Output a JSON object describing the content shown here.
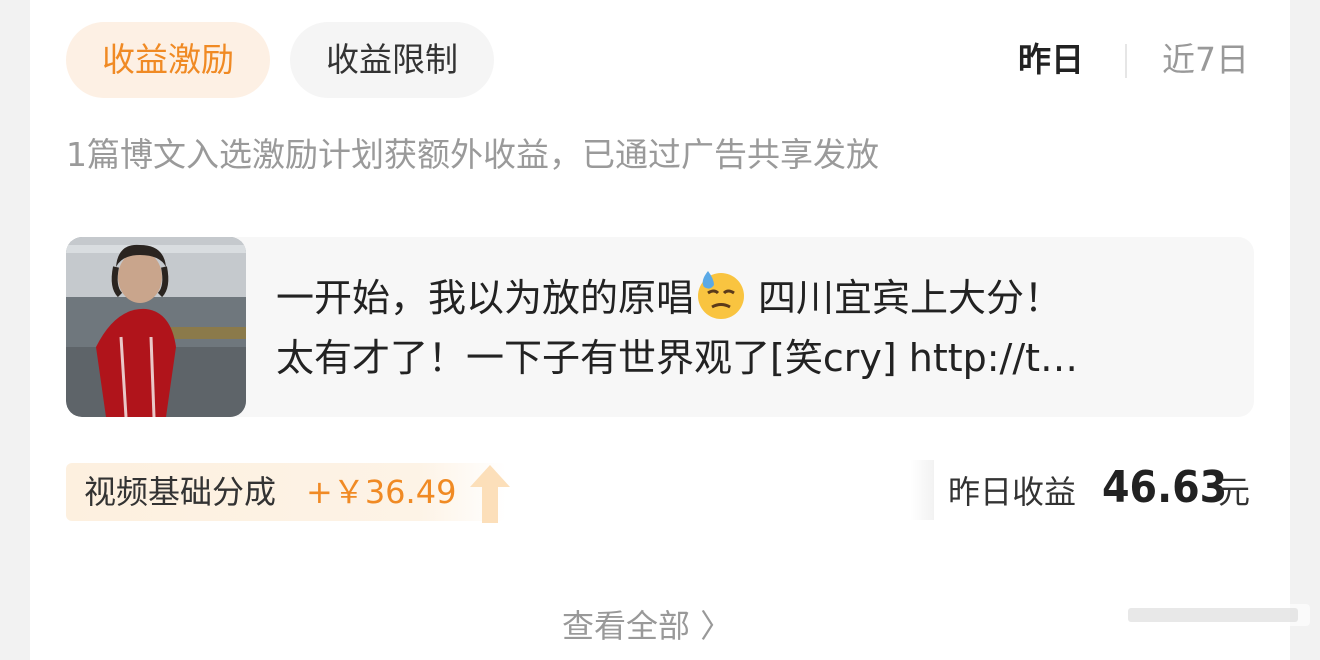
{
  "tabs": [
    {
      "label": "收益激励",
      "active": true
    },
    {
      "label": "收益限制",
      "active": false
    }
  ],
  "range": {
    "yesterday": "昨日",
    "last7days": "近7日"
  },
  "subtitle": "1篇博文入选激励计划获额外收益，已通过广告共享发放",
  "post": {
    "line1_a": "一开始，我以为放的原唱",
    "line1_emoji": "sweat-face-emoji",
    "line1_b": "四川宜宾上大分！",
    "line2": "太有才了！一下子有世界观了[笑cry] http://t…"
  },
  "revenue_share": {
    "label": "视频基础分成",
    "value": "+￥36.49",
    "trend_icon": "up-arrow-icon"
  },
  "yesterday_earnings": {
    "label": "昨日收益",
    "amount": "46.63",
    "unit": "元"
  },
  "view_all": "查看全部 〉",
  "colors": {
    "accent": "#f08a24",
    "accent_bg": "#fdf0e4",
    "text_primary": "#222222",
    "text_secondary": "#9a9a9a"
  }
}
